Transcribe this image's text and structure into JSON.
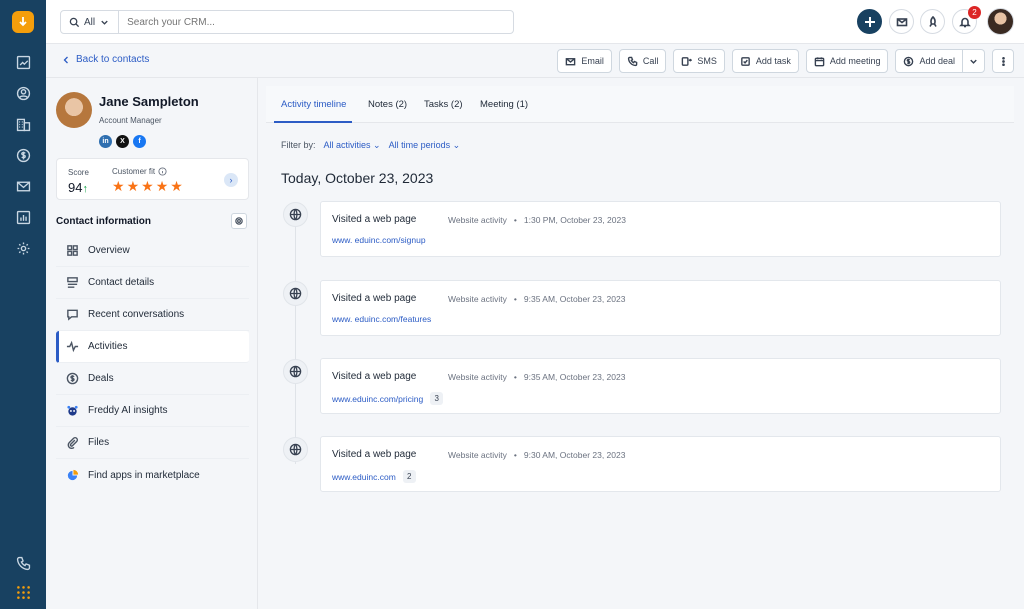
{
  "rail": {
    "logo_icon": "freshworks-logo-icon",
    "items": [
      "dashboard-icon",
      "contacts-icon",
      "accounts-icon",
      "deals-icon",
      "mail-icon",
      "reports-icon",
      "settings-icon"
    ],
    "bottom_items": [
      "phone-icon",
      "apps-grid-icon"
    ]
  },
  "topbar": {
    "search_scope": "All",
    "search_placeholder": "Search your CRM...",
    "notification_count": "2"
  },
  "subbar": {
    "back_label": "Back to contacts",
    "actions": {
      "email": "Email",
      "call": "Call",
      "sms": "SMS",
      "add_task": "Add task",
      "add_meeting": "Add meeting",
      "add_deal": "Add deal"
    }
  },
  "contact": {
    "name": "Jane Sampleton",
    "title": "Account Manager",
    "score_label": "Score",
    "score_value": "94",
    "score_trend": "↑",
    "fit_label": "Customer fit",
    "fit_rating": 5,
    "section_heading": "Contact information"
  },
  "nav": {
    "overview": "Overview",
    "contact_details": "Contact details",
    "recent_conversations": "Recent conversations",
    "activities": "Activities",
    "deals": "Deals",
    "freddy": "Freddy AI insights",
    "files": "Files",
    "find_apps": "Find apps in marketplace"
  },
  "tabs": {
    "activity_timeline": "Activity timeline",
    "notes": "Notes (2)",
    "tasks": "Tasks (2)",
    "meeting": "Meeting (1)"
  },
  "filter": {
    "label": "Filter by:",
    "activities": "All activities",
    "periods": "All time periods"
  },
  "timeline": {
    "date_heading": "Today, October 23, 2023",
    "entries": [
      {
        "title": "Visited a web page",
        "type": "Website activity",
        "time": "1:30 PM, October 23, 2023",
        "link": "www. eduinc.com/signup",
        "count": ""
      },
      {
        "title": "Visited a web page",
        "type": "Website activity",
        "time": "9:35 AM, October 23, 2023",
        "link": "www. eduinc.com/features",
        "count": ""
      },
      {
        "title": "Visited a web page",
        "type": "Website activity",
        "time": "9:35 AM, October 23, 2023",
        "link": "www.eduinc.com/pricing",
        "count": "3"
      },
      {
        "title": "Visited a web page",
        "type": "Website activity",
        "time": "9:30 AM, October 23, 2023",
        "link": "www.eduinc.com",
        "count": "2"
      }
    ]
  },
  "colors": {
    "rail": "#184161",
    "accent": "#2c5cc5",
    "star": "#f97316",
    "logo": "#f59e0b"
  }
}
